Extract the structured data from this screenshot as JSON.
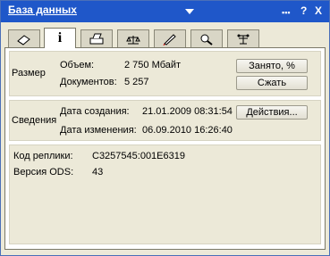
{
  "window": {
    "title": "База данных",
    "controls": {
      "more": "▪▪▪",
      "help": "?",
      "close": "X"
    }
  },
  "tabs": [
    {
      "name": "tab-basics",
      "icon": "eraser-icon",
      "active": false
    },
    {
      "name": "tab-info",
      "icon": "info-icon",
      "label": "i",
      "active": true
    },
    {
      "name": "tab-printing",
      "icon": "printer-icon",
      "active": false
    },
    {
      "name": "tab-replication",
      "icon": "scale-icon",
      "active": false
    },
    {
      "name": "tab-design",
      "icon": "pen-icon",
      "active": false
    },
    {
      "name": "tab-search",
      "icon": "search-icon",
      "active": false
    },
    {
      "name": "tab-advanced",
      "icon": "tools-icon",
      "active": false
    }
  ],
  "size_section": {
    "heading": "Размер",
    "volume_label": "Объем:",
    "volume_value": "2 750 Мбайт",
    "docs_label": "Документов:",
    "docs_value": "5 257",
    "used_button": "Занято, %",
    "compact_button": "Сжать"
  },
  "info_section": {
    "heading": "Сведения",
    "created_label": "Дата создания:",
    "created_value": "21.01.2009 08:31:54",
    "modified_label": "Дата изменения:",
    "modified_value": "06.09.2010 16:26:40",
    "actions_button": "Действия..."
  },
  "replica": {
    "id_label": "Код реплики:",
    "id_value": "C3257545:001E6319",
    "ods_label": "Версия ODS:",
    "ods_value": "43"
  }
}
